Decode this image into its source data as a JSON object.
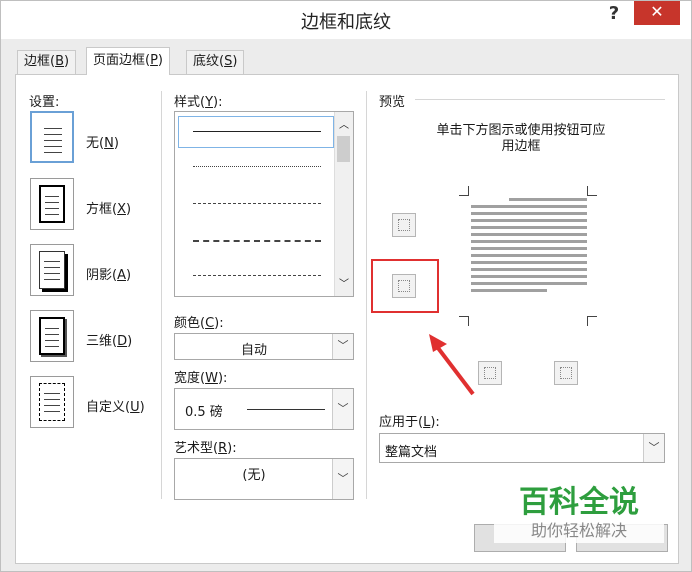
{
  "window": {
    "title": "边框和底纹"
  },
  "title_buttons": {
    "help": "?",
    "close": "✕"
  },
  "tabs": [
    {
      "label": "边框(",
      "key": "B",
      "end": ")"
    },
    {
      "label": "页面边框(",
      "key": "P",
      "end": ")"
    },
    {
      "label": "底纹(",
      "key": "S",
      "end": ")"
    }
  ],
  "settings": {
    "heading": "设置:",
    "items": [
      {
        "label": "无(",
        "key": "N",
        "end": ")"
      },
      {
        "label": "方框(",
        "key": "X",
        "end": ")"
      },
      {
        "label": "阴影(",
        "key": "A",
        "end": ")"
      },
      {
        "label": "三维(",
        "key": "D",
        "end": ")"
      },
      {
        "label": "自定义(",
        "key": "U",
        "end": ")"
      }
    ]
  },
  "style": {
    "label": "样式(",
    "key": "Y",
    "end": "):"
  },
  "color": {
    "label": "颜色(",
    "key": "C",
    "end": "):",
    "value": "自动"
  },
  "width": {
    "label": "宽度(",
    "key": "W",
    "end": "):",
    "value": "0.5 磅"
  },
  "art": {
    "label": "艺术型(",
    "key": "R",
    "end": "):",
    "value": "(无)"
  },
  "preview": {
    "heading": "预览",
    "hint_line1": "单击下方图示或使用按钮可应",
    "hint_line2": "用边框"
  },
  "apply_to": {
    "label": "应用于(",
    "key": "L",
    "end": "):",
    "value": "整篇文档"
  },
  "watermark": {
    "title": "百科全说",
    "subtitle": "助你轻松解决"
  },
  "colors": {
    "close_bg": "#c7352b",
    "highlight_red": "#e03030",
    "selection_blue": "#6aa0d6",
    "watermark_green": "#2e9e3e"
  }
}
